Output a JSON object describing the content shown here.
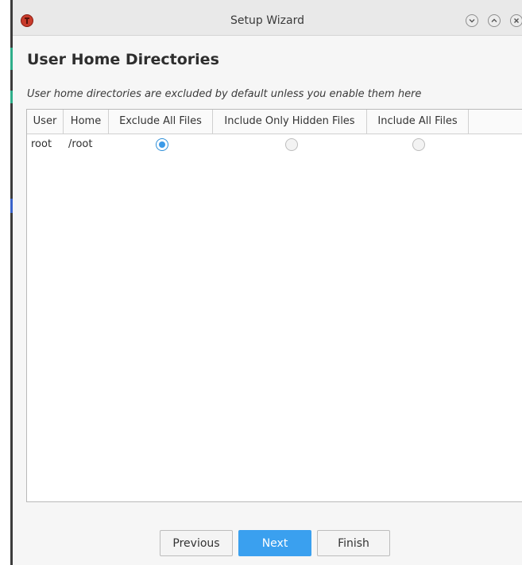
{
  "window": {
    "title": "Setup Wizard",
    "icons": {
      "app": "app-logo-icon",
      "minimize": "chevron-down-icon",
      "maximize": "chevron-up-icon",
      "close": "close-icon"
    }
  },
  "page": {
    "heading": "User Home Directories",
    "subtitle": "User home directories are excluded by default unless you enable them here"
  },
  "table": {
    "columns": [
      "User",
      "Home",
      "Exclude All Files",
      "Include Only Hidden Files",
      "Include All Files"
    ],
    "rows": [
      {
        "user": "root",
        "home": "/root",
        "selected_option": "Exclude All Files"
      }
    ]
  },
  "buttons": {
    "previous": "Previous",
    "next": "Next",
    "finish": "Finish"
  },
  "colors": {
    "accent": "#3aa0ef",
    "app_icon": "#c83b2b"
  }
}
